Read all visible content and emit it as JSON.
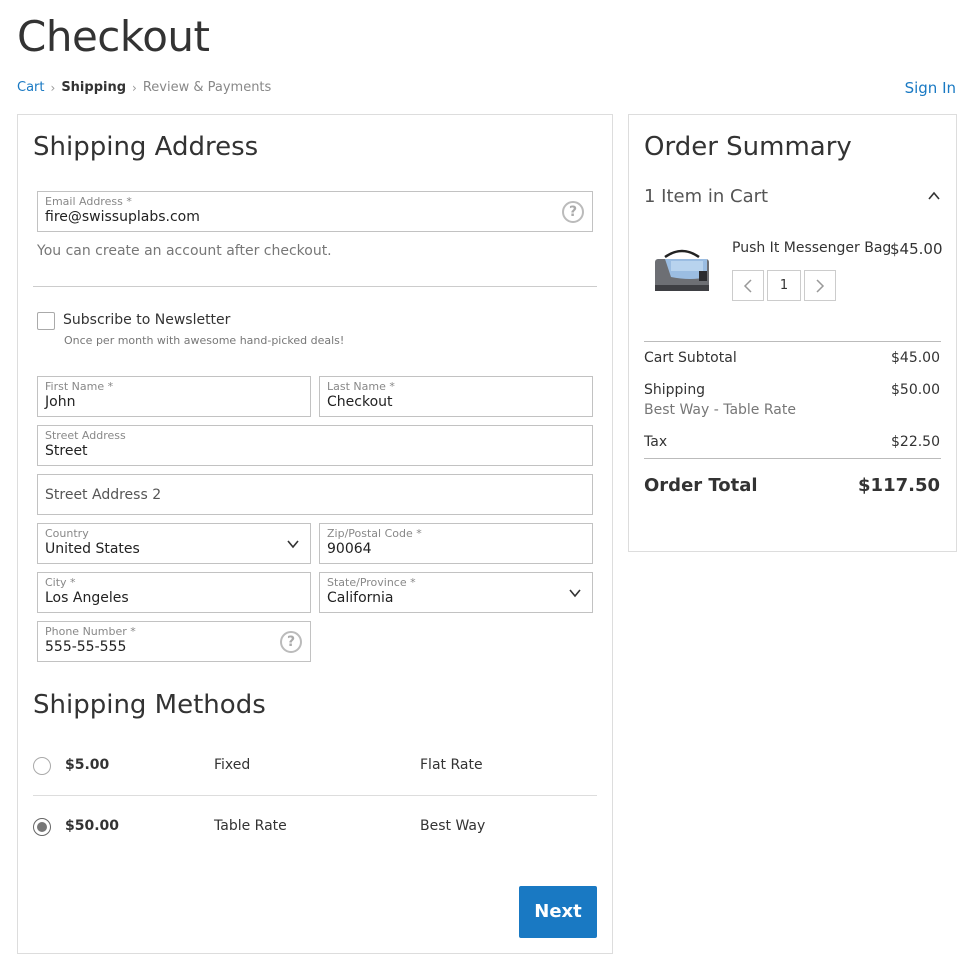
{
  "page": {
    "title": "Checkout",
    "sign_in": "Sign In"
  },
  "breadcrumb": {
    "cart": "Cart",
    "sep": "›",
    "shipping": "Shipping",
    "review": "Review & Payments"
  },
  "shipping_address": {
    "title": "Shipping Address",
    "email": {
      "label": "Email Address *",
      "value": "fire@swissuplabs.com"
    },
    "account_note": "You can create an account after checkout.",
    "newsletter": {
      "label": "Subscribe to Newsletter",
      "sub": "Once per month with awesome hand-picked deals!"
    },
    "first_name": {
      "label": "First Name *",
      "value": "John"
    },
    "last_name": {
      "label": "Last Name *",
      "value": "Checkout"
    },
    "street": {
      "label": "Street Address",
      "value": "Street"
    },
    "street2": {
      "placeholder": "Street Address 2"
    },
    "country": {
      "label": "Country",
      "value": "United States"
    },
    "zip": {
      "label": "Zip/Postal Code *",
      "value": "90064"
    },
    "city": {
      "label": "City *",
      "value": "Los Angeles"
    },
    "state": {
      "label": "State/Province *",
      "value": "California"
    },
    "phone": {
      "label": "Phone Number *",
      "value": "555-55-555"
    },
    "help_glyph": "?"
  },
  "shipping_methods": {
    "title": "Shipping Methods",
    "methods": [
      {
        "price": "$5.00",
        "method": "Fixed",
        "carrier": "Flat Rate",
        "selected": false
      },
      {
        "price": "$50.00",
        "method": "Table Rate",
        "carrier": "Best Way",
        "selected": true
      }
    ],
    "next_label": "Next"
  },
  "order_summary": {
    "title": "Order Summary",
    "items_count": "1 Item in Cart",
    "item": {
      "name": "Push It Messenger Bag",
      "price": "$45.00",
      "qty": "1"
    },
    "subtotal": {
      "label": "Cart Subtotal",
      "value": "$45.00"
    },
    "shipping": {
      "label": "Shipping",
      "value": "$50.00",
      "method": "Best Way - Table Rate"
    },
    "tax": {
      "label": "Tax",
      "value": "$22.50"
    },
    "total": {
      "label": "Order Total",
      "value": "$117.50"
    }
  },
  "colors": {
    "accent": "#1979c3",
    "border": "#dddddd"
  }
}
